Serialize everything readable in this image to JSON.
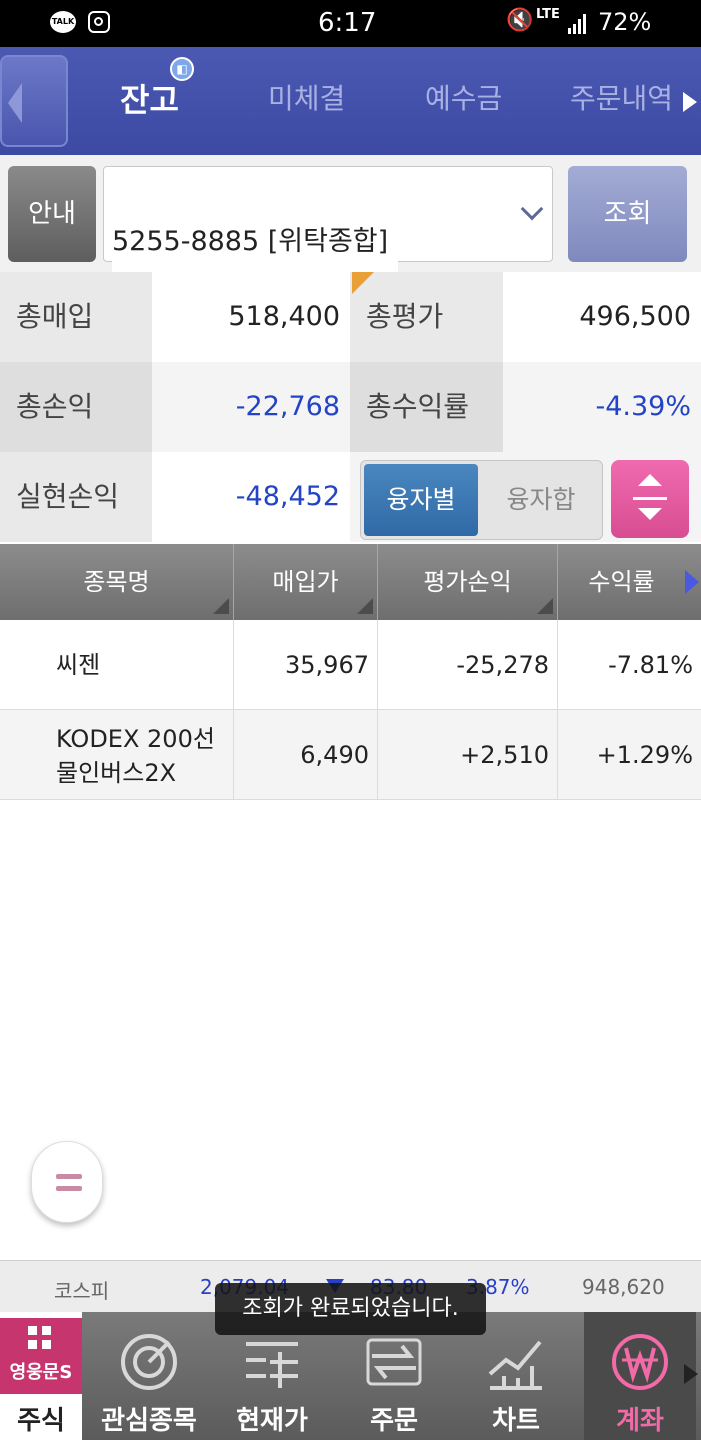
{
  "status": {
    "time": "6:17",
    "talk_label": "TALK",
    "network": "LTE",
    "battery": "72%"
  },
  "tabs": [
    {
      "label": "잔고",
      "active": true
    },
    {
      "label": "미체결"
    },
    {
      "label": "예수금"
    },
    {
      "label": "주문내역"
    }
  ],
  "account": {
    "info_button": "안내",
    "selected": "5255-8885 [위탁종합]",
    "query_button": "조회"
  },
  "summary": {
    "total_buy_label": "총매입",
    "total_buy": "518,400",
    "total_eval_label": "총평가",
    "total_eval": "496,500",
    "total_pl_label": "총손익",
    "total_pl": "-22,768",
    "total_return_label": "총수익률",
    "total_return": "-4.39%",
    "realized_label": "실현손익",
    "realized": "-48,452",
    "toggle_on": "융자별",
    "toggle_off": "융자합"
  },
  "table": {
    "headers": [
      "종목명",
      "매입가",
      "평가손익",
      "수익률"
    ],
    "rows": [
      {
        "name": "씨젠",
        "price": "35,967",
        "pl": "-25,278",
        "rate": "-7.81%"
      },
      {
        "name": "KODEX 200선\n물인버스2X",
        "price": "6,490",
        "pl": "+2,510",
        "rate": "+1.29%"
      }
    ]
  },
  "ticker": {
    "index_name": "코스피",
    "value": "2,079.04",
    "change": "83.80",
    "rate": "3.87%",
    "volume": "948,620"
  },
  "toast": "조회가 완료되었습니다.",
  "nav": [
    {
      "label": "주식",
      "logo": "영웅문S"
    },
    {
      "label": "관심종목"
    },
    {
      "label": "현재가"
    },
    {
      "label": "주문"
    },
    {
      "label": "차트"
    },
    {
      "label": "계좌",
      "active": true
    }
  ],
  "colors": {
    "tab_bg": "#4553ad",
    "negative": "#2344c4",
    "positive": "#d6226a",
    "active_nav": "#f46aa8"
  }
}
